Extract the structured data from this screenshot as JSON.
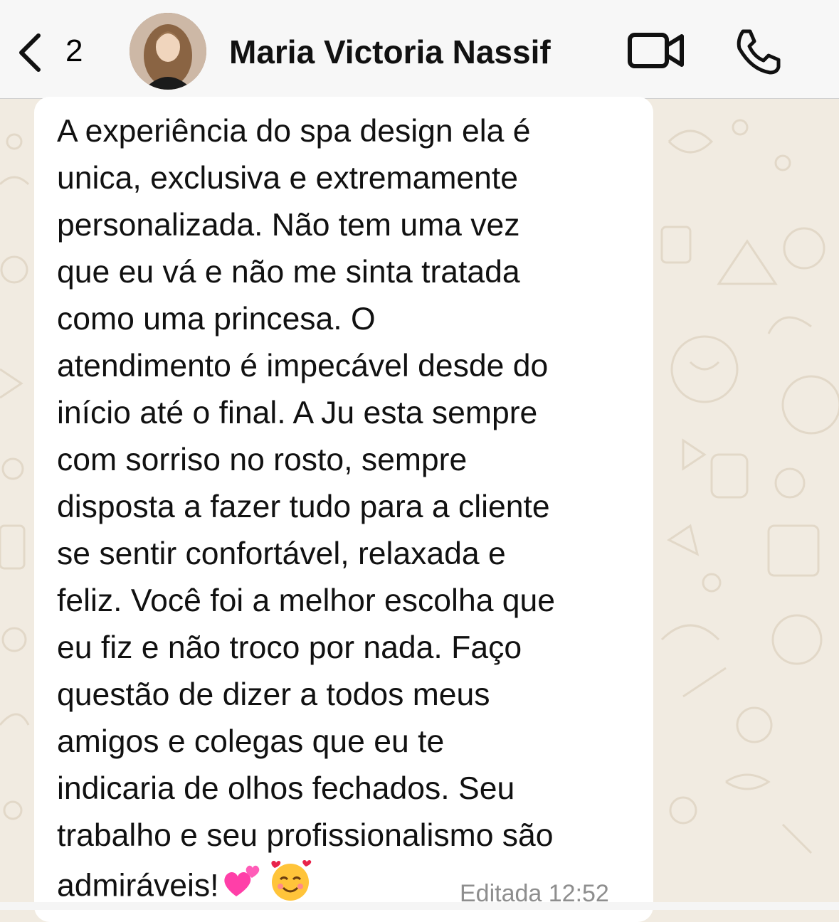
{
  "header": {
    "back_count": "2",
    "contact_name": "Maria Victoria Nassif",
    "icons": {
      "back": "chevron-left-icon",
      "video": "video-camera-icon",
      "call": "phone-icon"
    }
  },
  "message": {
    "lines": [
      "A experiência do spa design ela é",
      "unica, exclusiva e extremamente",
      "personalizada. Não tem uma vez",
      "que eu vá e não me sinta tratada",
      "como uma princesa. O",
      "atendimento é impecável desde do",
      "início até o final. A Ju esta sempre",
      "com sorriso no rosto, sempre",
      "disposta a fazer tudo para a cliente",
      "se sentir confortável, relaxada e",
      "feliz. Você foi a melhor escolha que",
      "eu fiz e não troco por nada. Faço",
      "questão de dizer a todos meus",
      "amigos e colegas que eu te",
      "indicaria de olhos fechados. Seu",
      "trabalho e seu profissionalismo são"
    ],
    "last_line": "admiráveis!",
    "emojis": [
      "two-hearts-emoji",
      "smiling-face-with-hearts-emoji"
    ],
    "meta": "Editada 12:52"
  },
  "colors": {
    "chat_background": "#f1ebe1",
    "bubble": "#ffffff",
    "header": "#f7f7f7",
    "meta_text": "#8e8e8e"
  }
}
